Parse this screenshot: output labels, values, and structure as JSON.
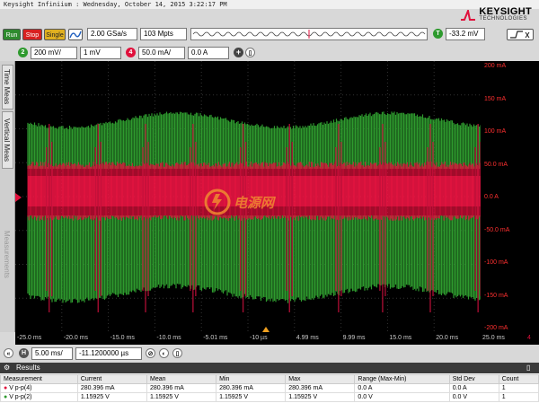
{
  "window": {
    "title": "Keysight Infiniium : Wednesday, October 14, 2015 3:22:17 PM"
  },
  "logo": {
    "brand": "KEYSIGHT",
    "sub": "TECHNOLOGIES"
  },
  "acquisition": {
    "run_label": "Run",
    "stop_label": "Stop",
    "single_label": "Single",
    "sample_rate": "2.00 GSa/s",
    "memory_depth": "103 Mpts",
    "trigger_badge": "T",
    "trigger_level": "-33.2 mV"
  },
  "channels": {
    "ch2_badge": "2",
    "ch2_scale": "200 mV/",
    "ch2_offset": "1 mV",
    "ch4_badge": "4",
    "ch4_scale": "50.0 mA/",
    "ch4_offset": "0.0 A"
  },
  "tabs": {
    "time_meas": "Time Meas",
    "vertical_meas": "Vertical Meas",
    "measurements": "Measurements"
  },
  "watermark": "电源网",
  "right_axis": [
    "200 mA",
    "150 mA",
    "100 mA",
    "50.0 mA",
    "0.0 A",
    "-50.0 mA",
    "-100 mA",
    "-150 mA",
    "-200 mA"
  ],
  "x_axis": [
    "-25.0 ms",
    "-20.0 ms",
    "-15.0 ms",
    "-10.0 ms",
    "-5.01 ms",
    "-10 µs",
    "4.99 ms",
    "9.99 ms",
    "15.0 ms",
    "20.0 ms",
    "25.0 ms"
  ],
  "x_axis_end": "4",
  "timebase": {
    "badge": "H",
    "scale": "5.00 ms/",
    "position": "-11.1200000 µs"
  },
  "results": {
    "title": "Results",
    "columns": [
      "Measurement",
      "Current",
      "Mean",
      "Min",
      "Max",
      "Range (Max-Min)",
      "Std Dev",
      "Count"
    ],
    "rows": [
      [
        "V p-p(4)",
        "280.396 mA",
        "280.396 mA",
        "280.396 mA",
        "280.396 mA",
        "0.0 A",
        "0.0 A",
        "1"
      ],
      [
        "V p-p(2)",
        "1.15925 V",
        "1.15925 V",
        "1.15925 V",
        "1.15925 V",
        "0.0 V",
        "0.0 V",
        "1"
      ]
    ]
  },
  "colors": {
    "ch2": "#2e9a2e",
    "ch4": "#e0103c",
    "run": "#2e8b2e",
    "stop": "#d82020",
    "single": "#e0b020"
  }
}
